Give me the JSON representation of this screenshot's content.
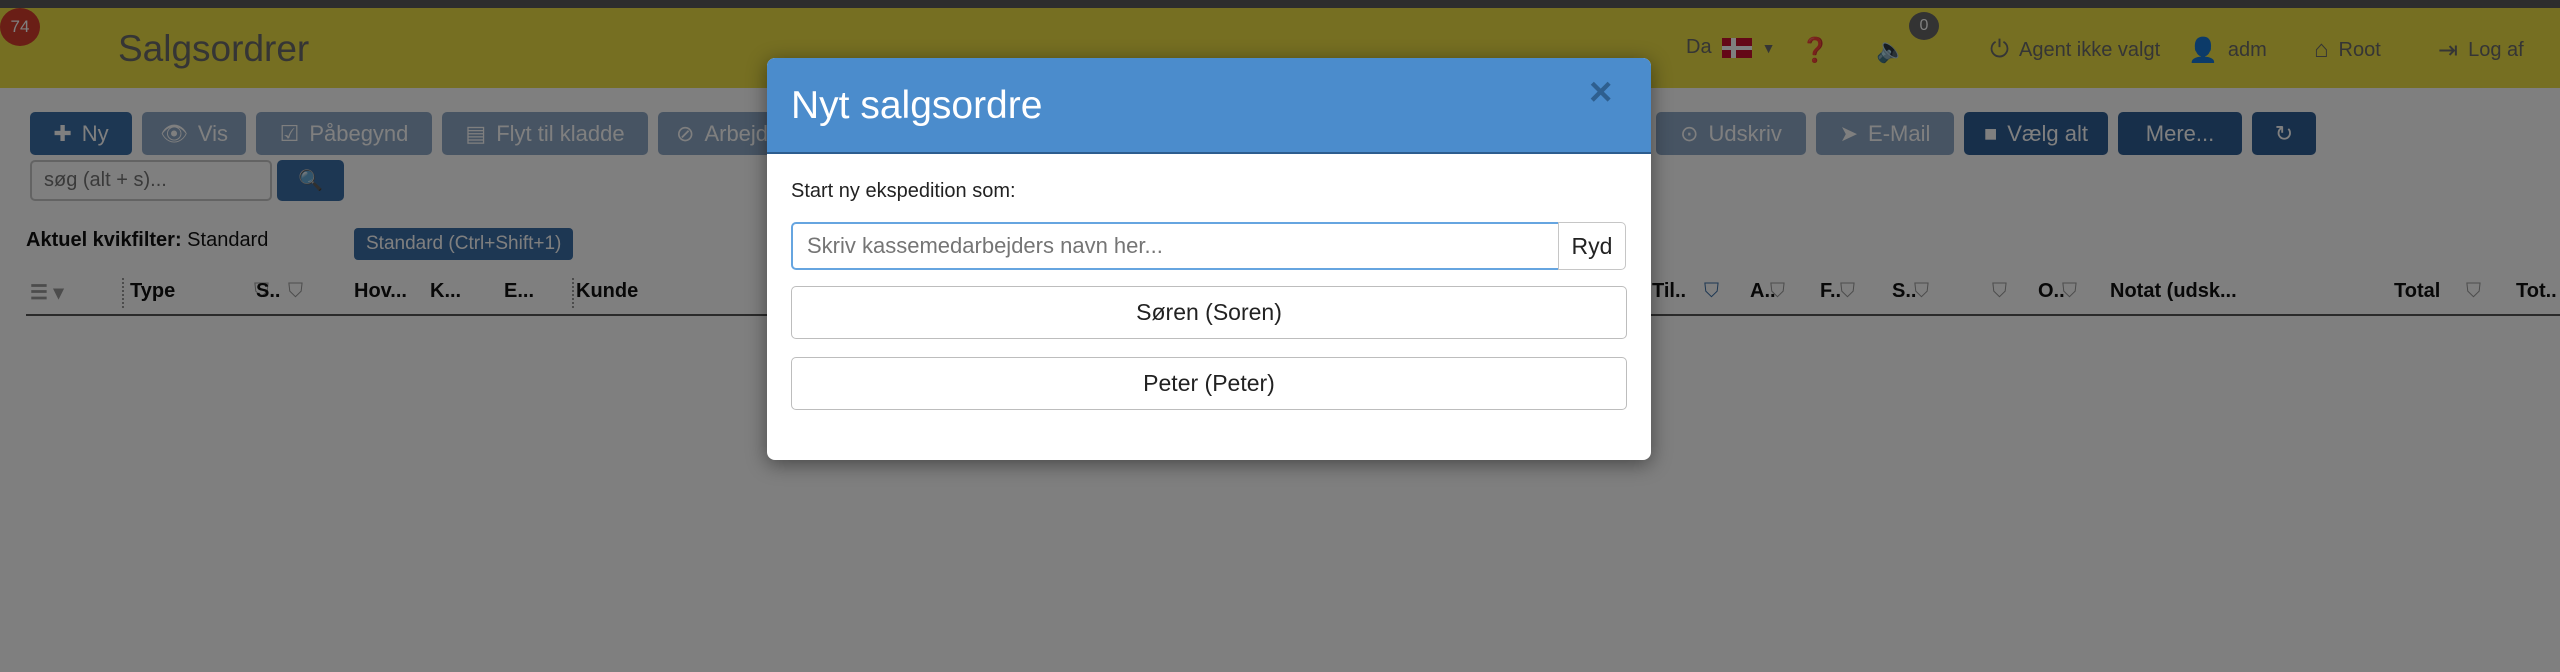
{
  "header": {
    "notification_count": "74",
    "app_title": "Salgsordrer",
    "language": "Da",
    "sound_count": "0",
    "agent": "Agent ikke valgt",
    "user": "adm",
    "home": "Root",
    "logout": "Log af",
    "bg_color": "#ecdf44"
  },
  "toolbar": {
    "new": "Ny",
    "view": "Vis",
    "begin": "Påbegynd",
    "move_draft": "Flyt til kladde",
    "work": "Arbejd",
    "print": "Udskriv",
    "email": "E-Mail",
    "select_all": "Vælg alt",
    "more": "Mere...",
    "refresh_icon": "refresh-icon"
  },
  "search": {
    "placeholder": "søg (alt + s)...",
    "button_icon": "search-icon"
  },
  "quickfilter": {
    "label": "Aktuel kvikfilter:",
    "value": "Standard",
    "chip": "Standard (Ctrl+Shift+1)"
  },
  "grid": {
    "columns_left": [
      "Type",
      "S..",
      "Hov...",
      "K...",
      "E...",
      "Kunde"
    ],
    "columns_right": [
      "Til..",
      "A..",
      "F..",
      "S..",
      "O..",
      "Notat (udsk...",
      "Total",
      "Tot.."
    ]
  },
  "modal": {
    "title": "Nyt salgsordre",
    "close": "×",
    "label": "Start ny ekspedition som:",
    "input_placeholder": "Skriv kassemedarbejders navn her...",
    "clear_button": "Ryd",
    "staff": [
      "Søren (Soren)",
      "Peter (Peter)"
    ],
    "header_color": "#4b8ccc"
  }
}
